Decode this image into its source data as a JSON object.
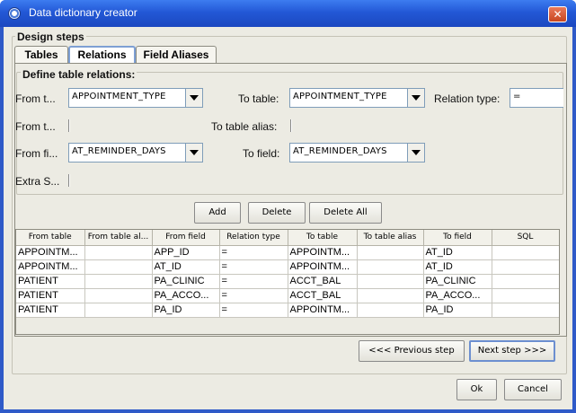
{
  "window": {
    "title": "Data dictionary creator",
    "close_glyph": "✕"
  },
  "design_steps_label": "Design steps",
  "tabs": [
    {
      "label": "Tables",
      "active": false
    },
    {
      "label": "Relations",
      "active": true
    },
    {
      "label": "Field Aliases",
      "active": false
    }
  ],
  "relations": {
    "group_title": "Define table relations:",
    "from_table_label": "From t...",
    "from_table_value": "APPOINTMENT_TYPE",
    "to_table_label": "To table:",
    "to_table_value": "APPOINTMENT_TYPE",
    "relation_type_label": "Relation type:",
    "relation_type_value": "=",
    "from_alias_label": "From t...",
    "to_alias_label": "To table alias:",
    "from_field_label": "From fi...",
    "from_field_value": "AT_REMINDER_DAYS",
    "to_field_label": "To field:",
    "to_field_value": "AT_REMINDER_DAYS",
    "extra_sql_label": "Extra S..."
  },
  "actions": {
    "add": "Add",
    "delete": "Delete",
    "delete_all": "Delete All"
  },
  "table": {
    "columns": [
      "From table",
      "From table al...",
      "From field",
      "Relation type",
      "To table",
      "To table alias",
      "To field",
      "SQL"
    ],
    "rows": [
      [
        "APPOINTM...",
        "",
        "APP_ID",
        "=",
        "APPOINTM...",
        "",
        "AT_ID",
        ""
      ],
      [
        "APPOINTM...",
        "",
        "AT_ID",
        "=",
        "APPOINTM...",
        "",
        "AT_ID",
        ""
      ],
      [
        "PATIENT",
        "",
        "PA_CLINIC",
        "=",
        "ACCT_BAL",
        "",
        "PA_CLINIC",
        ""
      ],
      [
        "PATIENT",
        "",
        "PA_ACCO...",
        "=",
        "ACCT_BAL",
        "",
        "PA_ACCO...",
        ""
      ],
      [
        "PATIENT",
        "",
        "PA_ID",
        "=",
        "APPOINTM...",
        "",
        "PA_ID",
        ""
      ]
    ]
  },
  "nav": {
    "previous": "<<< Previous step",
    "next": "Next step >>>"
  },
  "footer": {
    "ok": "Ok",
    "cancel": "Cancel"
  },
  "icons": {
    "window": "app-icon",
    "close": "close-icon",
    "dropdown": "chevron-down-icon"
  },
  "colors": {
    "titlebar": "#2358d6",
    "background": "#ecebe3",
    "active_tab_border": "#7ea0d4"
  }
}
